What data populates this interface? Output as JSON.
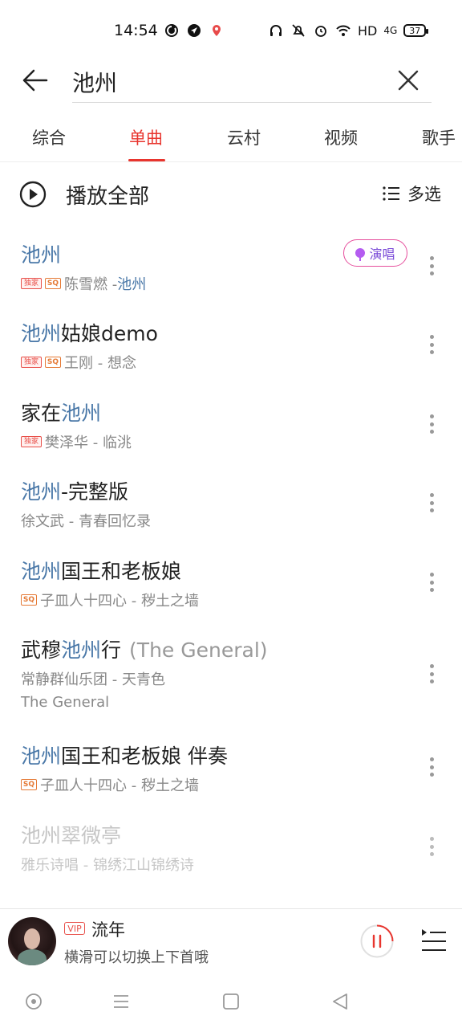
{
  "status_bar": {
    "time": "14:54",
    "network_label": "HD",
    "cell_label": "4G",
    "battery": "37",
    "left_icons": [
      "netease-icon",
      "direction-icon",
      "location-icon"
    ],
    "right_icons": [
      "headphones-icon",
      "mute-icon",
      "alarm-icon",
      "wifi-icon"
    ]
  },
  "search": {
    "query": "池州",
    "placeholder": ""
  },
  "tabs": [
    {
      "label": "综合",
      "active": false
    },
    {
      "label": "单曲",
      "active": true
    },
    {
      "label": "云村",
      "active": false
    },
    {
      "label": "视频",
      "active": false
    },
    {
      "label": "歌手",
      "active": false
    }
  ],
  "actions": {
    "play_all": "播放全部",
    "multi_select": "多选"
  },
  "songs": [
    {
      "title_hl": "池州",
      "title_rest": "",
      "title_extra": "",
      "badges": [
        "独家",
        "SQ"
      ],
      "artist": "陈雪燃 - ",
      "album": "池州",
      "album_highlight": true,
      "sing_label": "演唱",
      "disabled": false
    },
    {
      "title_pre": "",
      "title_hl": "池州",
      "title_rest": "姑娘demo",
      "title_extra": "",
      "badges": [
        "独家",
        "SQ"
      ],
      "artist": "王刚 - 想念",
      "disabled": false
    },
    {
      "title_pre": "家在",
      "title_hl": "池州",
      "title_rest": "",
      "title_extra": "",
      "badges": [
        "独家"
      ],
      "artist": "樊泽华 - 临洮",
      "disabled": false
    },
    {
      "title_pre": "",
      "title_hl": "池州",
      "title_rest": "-完整版",
      "title_extra": "",
      "badges": [],
      "artist": "徐文武 - 青春回忆录",
      "disabled": false
    },
    {
      "title_pre": "",
      "title_hl": "池州",
      "title_rest": "国王和老板娘",
      "title_extra": "",
      "badges": [
        "SQ"
      ],
      "artist": "子皿人十四心 - 秽土之墙",
      "disabled": false
    },
    {
      "title_pre": "武穆",
      "title_hl": "池州",
      "title_rest": "行",
      "title_extra": "(The General)",
      "badges": [],
      "artist": "常静群仙乐团 - 天青色",
      "secondary": "The General",
      "disabled": false
    },
    {
      "title_pre": "",
      "title_hl": "池州",
      "title_rest": "国王和老板娘 伴奏",
      "title_extra": "",
      "badges": [
        "SQ"
      ],
      "artist": "子皿人十四心 - 秽土之墙",
      "disabled": false
    },
    {
      "title_pre": "",
      "title_hl": "池州",
      "title_rest": "翠微亭",
      "title_extra": "",
      "badges": [],
      "artist": "雅乐诗唱 - 锦绣江山锦绣诗",
      "disabled": true
    }
  ],
  "player": {
    "vip": "VIP",
    "title": "流年",
    "subtitle": "横滑可以切换上下首哦"
  },
  "colors": {
    "accent": "#e8352e",
    "highlight": "#4a78a8"
  }
}
